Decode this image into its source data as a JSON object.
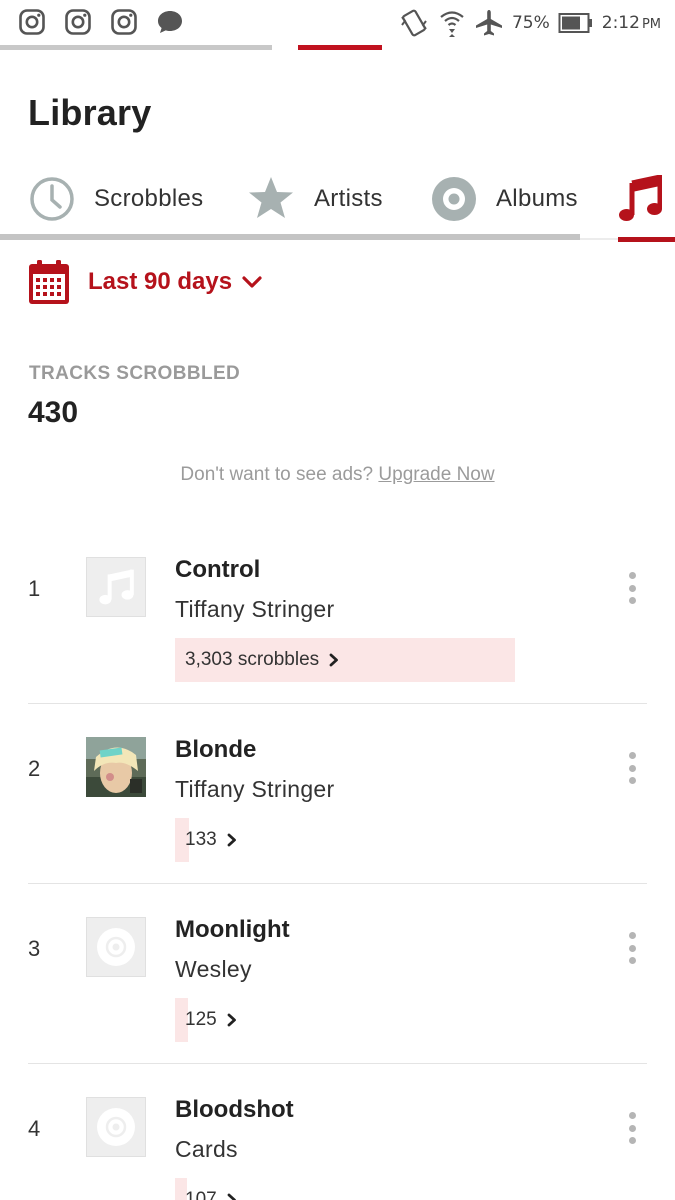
{
  "status_bar": {
    "left_icons": [
      "instagram-icon",
      "instagram-icon",
      "instagram-icon",
      "message-bubble-icon"
    ],
    "battery_text": "75%",
    "time": "2:12",
    "ampm": "PM"
  },
  "page": {
    "title": "Library"
  },
  "tabs": [
    {
      "label": "Scrobbles",
      "icon": "clock-icon",
      "active": false
    },
    {
      "label": "Artists",
      "icon": "star-icon",
      "active": false
    },
    {
      "label": "Albums",
      "icon": "disc-icon",
      "active": false
    },
    {
      "label": "",
      "icon": "music-note-icon",
      "active": true
    }
  ],
  "date_filter": {
    "label": "Last 90 days"
  },
  "stats": {
    "label": "TRACKS SCROBBLED",
    "value": "430"
  },
  "ad": {
    "text": "Don't want to see ads?",
    "link": "Upgrade Now"
  },
  "tracks": [
    {
      "rank": "1",
      "title": "Control",
      "artist": "Tiffany Stringer",
      "scrobbles": "3,303 scrobbles",
      "bar_fraction": 1.0,
      "art": "music-note-placeholder"
    },
    {
      "rank": "2",
      "title": "Blonde",
      "artist": "Tiffany Stringer",
      "scrobbles": "133",
      "bar_fraction": 0.04,
      "art": "album-photo"
    },
    {
      "rank": "3",
      "title": "Moonlight",
      "artist": "Wesley",
      "scrobbles": "125",
      "bar_fraction": 0.038,
      "art": "disc-placeholder"
    },
    {
      "rank": "4",
      "title": "Bloodshot",
      "artist": "Cards",
      "scrobbles": "107",
      "bar_fraction": 0.032,
      "art": "disc-placeholder"
    }
  ],
  "colors": {
    "accent": "#b5121b",
    "bar": "#fbe6e6",
    "muted": "#9b9b9b"
  }
}
